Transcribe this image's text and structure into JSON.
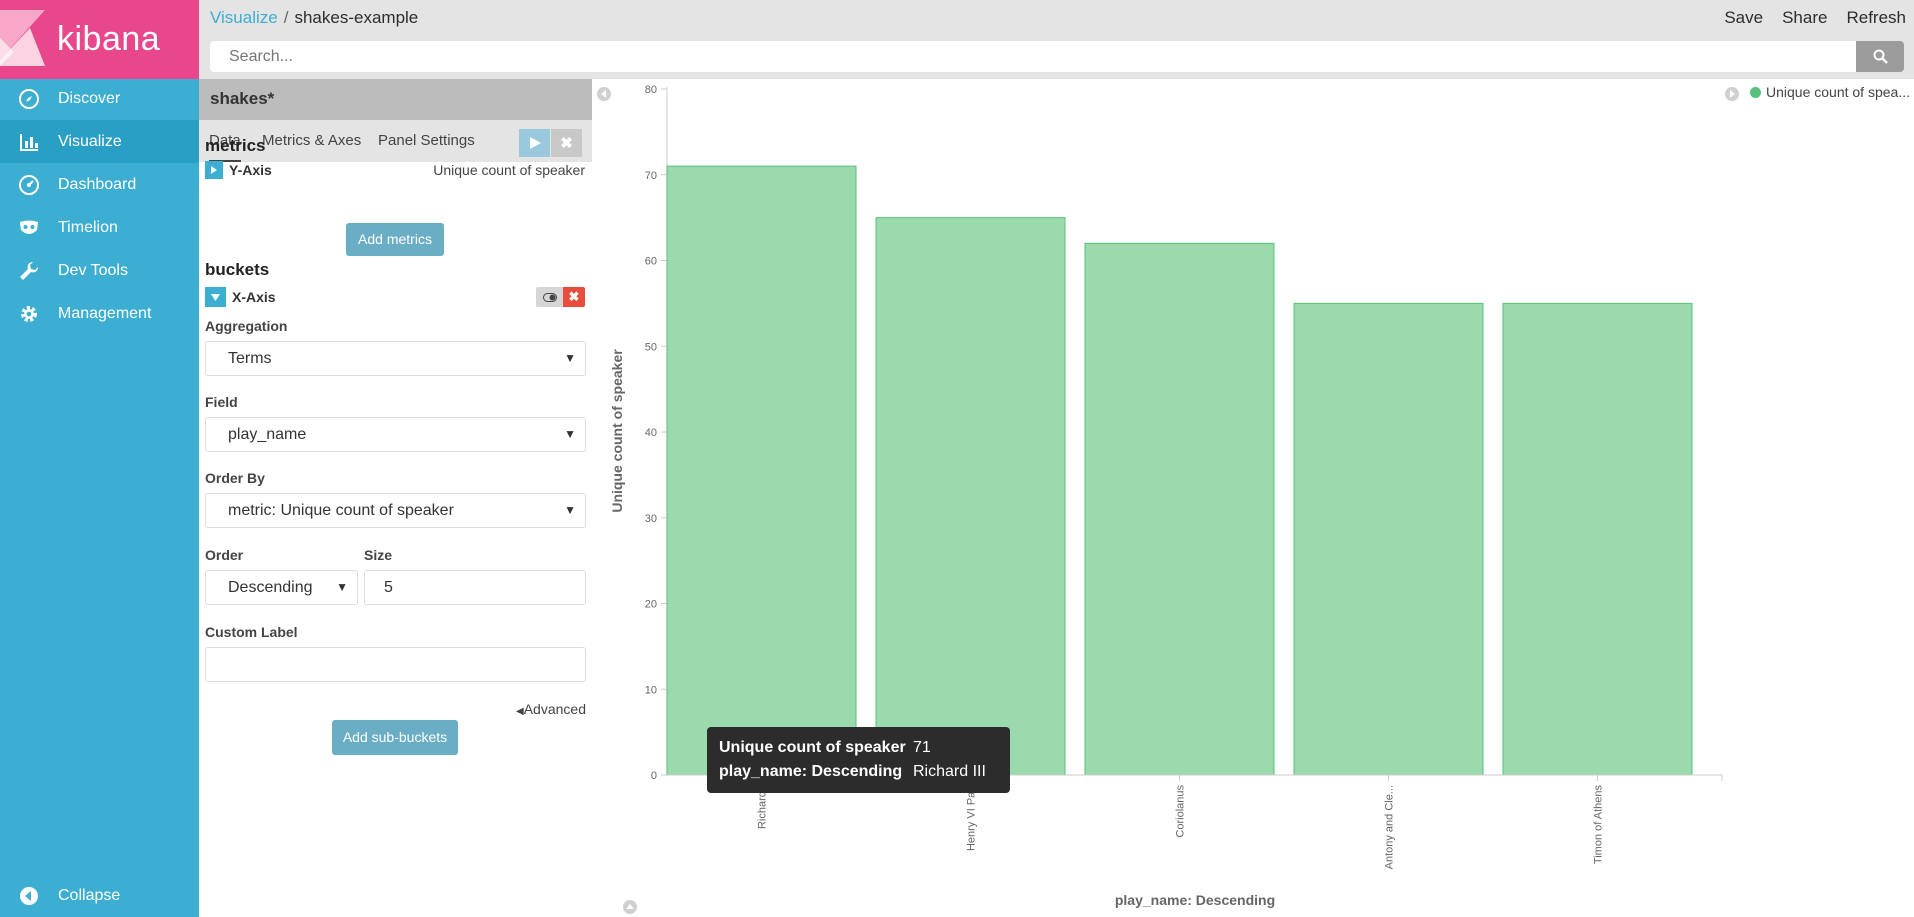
{
  "app": {
    "name": "kibana"
  },
  "sidebar": {
    "items": [
      {
        "label": "Discover",
        "icon": "compass-icon"
      },
      {
        "label": "Visualize",
        "icon": "bar-chart-icon",
        "active": true
      },
      {
        "label": "Dashboard",
        "icon": "gauge-icon"
      },
      {
        "label": "Timelion",
        "icon": "mask-icon"
      },
      {
        "label": "Dev Tools",
        "icon": "wrench-icon"
      },
      {
        "label": "Management",
        "icon": "gear-icon"
      }
    ],
    "collapse_label": "Collapse"
  },
  "header": {
    "breadcrumb_link": "Visualize",
    "breadcrumb_sep": "/",
    "breadcrumb_current": "shakes-example",
    "actions": [
      "Save",
      "Share",
      "Refresh"
    ],
    "search_placeholder": "Search..."
  },
  "editor": {
    "index_pattern": "shakes*",
    "tabs": [
      "Data",
      "Metrics & Axes",
      "Panel Settings"
    ],
    "metrics_title": "metrics",
    "metric": {
      "label": "Y-Axis",
      "value": "Unique count of speaker"
    },
    "add_metrics": "Add metrics",
    "buckets_title": "buckets",
    "bucket": {
      "label": "X-Axis"
    },
    "aggregation_label": "Aggregation",
    "aggregation_value": "Terms",
    "field_label": "Field",
    "field_value": "play_name",
    "orderby_label": "Order By",
    "orderby_value": "metric: Unique count of speaker",
    "order_label": "Order",
    "order_value": "Descending",
    "size_label": "Size",
    "size_value": "5",
    "custom_label": "Custom Label",
    "custom_value": "",
    "advanced": "Advanced",
    "add_subbuckets": "Add sub-buckets"
  },
  "tooltip": {
    "rows": [
      {
        "key": "Unique count of speaker",
        "value": "71"
      },
      {
        "key": "play_name: Descending",
        "value": "Richard III"
      }
    ]
  },
  "legend": {
    "label": "Unique count of spea...",
    "color": "#57c17b"
  },
  "colors": {
    "bar_fill": "#9adaad",
    "bar_stroke": "#57c17b",
    "sidebar": "#3caed2",
    "logo": "#e8488b"
  },
  "chart_data": {
    "type": "bar",
    "categories": [
      "Richard III",
      "Henry VI Part",
      "Coriolanus",
      "Antony and Cle...",
      "Timon of Athens"
    ],
    "tick_labels": [
      "Richard I",
      "Henry VI Part",
      "Coriolanus",
      "Antony and Cle...",
      "Timon of Athens"
    ],
    "values": [
      71,
      65,
      62,
      55,
      55
    ],
    "ylabel": "Unique count of speaker",
    "xlabel": "play_name: Descending",
    "ylim": [
      0,
      80
    ],
    "yticks": [
      0,
      10,
      20,
      30,
      40,
      50,
      60,
      70,
      80
    ],
    "grid": false,
    "legend_position": "top-right"
  }
}
